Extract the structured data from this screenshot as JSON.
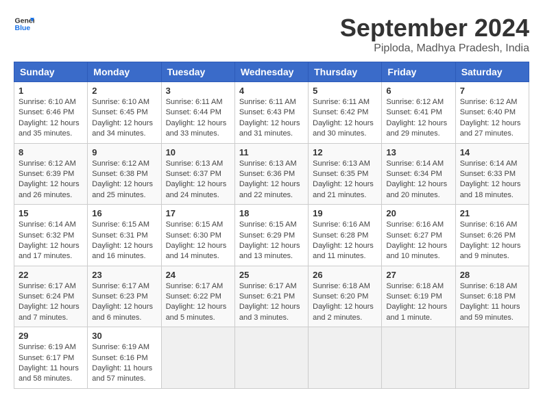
{
  "header": {
    "logo_line1": "General",
    "logo_line2": "Blue",
    "month_title": "September 2024",
    "location": "Piploda, Madhya Pradesh, India"
  },
  "weekdays": [
    "Sunday",
    "Monday",
    "Tuesday",
    "Wednesday",
    "Thursday",
    "Friday",
    "Saturday"
  ],
  "weeks": [
    [
      {
        "day": "1",
        "info": "Sunrise: 6:10 AM\nSunset: 6:46 PM\nDaylight: 12 hours\nand 35 minutes."
      },
      {
        "day": "2",
        "info": "Sunrise: 6:10 AM\nSunset: 6:45 PM\nDaylight: 12 hours\nand 34 minutes."
      },
      {
        "day": "3",
        "info": "Sunrise: 6:11 AM\nSunset: 6:44 PM\nDaylight: 12 hours\nand 33 minutes."
      },
      {
        "day": "4",
        "info": "Sunrise: 6:11 AM\nSunset: 6:43 PM\nDaylight: 12 hours\nand 31 minutes."
      },
      {
        "day": "5",
        "info": "Sunrise: 6:11 AM\nSunset: 6:42 PM\nDaylight: 12 hours\nand 30 minutes."
      },
      {
        "day": "6",
        "info": "Sunrise: 6:12 AM\nSunset: 6:41 PM\nDaylight: 12 hours\nand 29 minutes."
      },
      {
        "day": "7",
        "info": "Sunrise: 6:12 AM\nSunset: 6:40 PM\nDaylight: 12 hours\nand 27 minutes."
      }
    ],
    [
      {
        "day": "8",
        "info": "Sunrise: 6:12 AM\nSunset: 6:39 PM\nDaylight: 12 hours\nand 26 minutes."
      },
      {
        "day": "9",
        "info": "Sunrise: 6:12 AM\nSunset: 6:38 PM\nDaylight: 12 hours\nand 25 minutes."
      },
      {
        "day": "10",
        "info": "Sunrise: 6:13 AM\nSunset: 6:37 PM\nDaylight: 12 hours\nand 24 minutes."
      },
      {
        "day": "11",
        "info": "Sunrise: 6:13 AM\nSunset: 6:36 PM\nDaylight: 12 hours\nand 22 minutes."
      },
      {
        "day": "12",
        "info": "Sunrise: 6:13 AM\nSunset: 6:35 PM\nDaylight: 12 hours\nand 21 minutes."
      },
      {
        "day": "13",
        "info": "Sunrise: 6:14 AM\nSunset: 6:34 PM\nDaylight: 12 hours\nand 20 minutes."
      },
      {
        "day": "14",
        "info": "Sunrise: 6:14 AM\nSunset: 6:33 PM\nDaylight: 12 hours\nand 18 minutes."
      }
    ],
    [
      {
        "day": "15",
        "info": "Sunrise: 6:14 AM\nSunset: 6:32 PM\nDaylight: 12 hours\nand 17 minutes."
      },
      {
        "day": "16",
        "info": "Sunrise: 6:15 AM\nSunset: 6:31 PM\nDaylight: 12 hours\nand 16 minutes."
      },
      {
        "day": "17",
        "info": "Sunrise: 6:15 AM\nSunset: 6:30 PM\nDaylight: 12 hours\nand 14 minutes."
      },
      {
        "day": "18",
        "info": "Sunrise: 6:15 AM\nSunset: 6:29 PM\nDaylight: 12 hours\nand 13 minutes."
      },
      {
        "day": "19",
        "info": "Sunrise: 6:16 AM\nSunset: 6:28 PM\nDaylight: 12 hours\nand 11 minutes."
      },
      {
        "day": "20",
        "info": "Sunrise: 6:16 AM\nSunset: 6:27 PM\nDaylight: 12 hours\nand 10 minutes."
      },
      {
        "day": "21",
        "info": "Sunrise: 6:16 AM\nSunset: 6:26 PM\nDaylight: 12 hours\nand 9 minutes."
      }
    ],
    [
      {
        "day": "22",
        "info": "Sunrise: 6:17 AM\nSunset: 6:24 PM\nDaylight: 12 hours\nand 7 minutes."
      },
      {
        "day": "23",
        "info": "Sunrise: 6:17 AM\nSunset: 6:23 PM\nDaylight: 12 hours\nand 6 minutes."
      },
      {
        "day": "24",
        "info": "Sunrise: 6:17 AM\nSunset: 6:22 PM\nDaylight: 12 hours\nand 5 minutes."
      },
      {
        "day": "25",
        "info": "Sunrise: 6:17 AM\nSunset: 6:21 PM\nDaylight: 12 hours\nand 3 minutes."
      },
      {
        "day": "26",
        "info": "Sunrise: 6:18 AM\nSunset: 6:20 PM\nDaylight: 12 hours\nand 2 minutes."
      },
      {
        "day": "27",
        "info": "Sunrise: 6:18 AM\nSunset: 6:19 PM\nDaylight: 12 hours\nand 1 minute."
      },
      {
        "day": "28",
        "info": "Sunrise: 6:18 AM\nSunset: 6:18 PM\nDaylight: 11 hours\nand 59 minutes."
      }
    ],
    [
      {
        "day": "29",
        "info": "Sunrise: 6:19 AM\nSunset: 6:17 PM\nDaylight: 11 hours\nand 58 minutes."
      },
      {
        "day": "30",
        "info": "Sunrise: 6:19 AM\nSunset: 6:16 PM\nDaylight: 11 hours\nand 57 minutes."
      },
      {
        "day": "",
        "info": ""
      },
      {
        "day": "",
        "info": ""
      },
      {
        "day": "",
        "info": ""
      },
      {
        "day": "",
        "info": ""
      },
      {
        "day": "",
        "info": ""
      }
    ]
  ]
}
